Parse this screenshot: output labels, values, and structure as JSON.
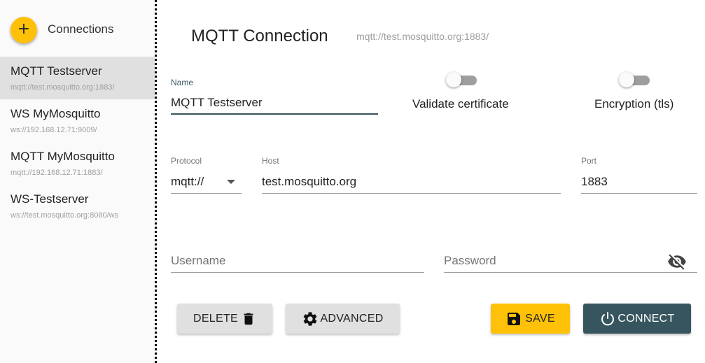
{
  "sidebar": {
    "title": "Connections",
    "add_icon": "plus-icon",
    "items": [
      {
        "name": "MQTT Testserver",
        "url": "mqtt://test.mosquitto.org:1883/",
        "selected": true
      },
      {
        "name": "WS MyMosquitto",
        "url": "ws://192.168.12.71:9009/",
        "selected": false
      },
      {
        "name": "MQTT MyMosquitto",
        "url": "mqtt://192.168.12.71:1883/",
        "selected": false
      },
      {
        "name": "WS-Testserver",
        "url": "ws://test.mosquitto.org:8080/ws",
        "selected": false
      }
    ]
  },
  "header": {
    "title": "MQTT Connection",
    "url": "mqtt://test.mosquitto.org:1883/"
  },
  "form": {
    "name_label": "Name",
    "name_value": "MQTT Testserver",
    "validate_label": "Validate certificate",
    "validate_on": false,
    "encryption_label": "Encryption (tls)",
    "encryption_on": false,
    "protocol_label": "Protocol",
    "protocol_value": "mqtt://",
    "host_label": "Host",
    "host_value": "test.mosquitto.org",
    "port_label": "Port",
    "port_value": "1883",
    "username_placeholder": "Username",
    "password_placeholder": "Password",
    "password_toggle_icon": "eye-off-icon"
  },
  "actions": {
    "delete_label": "DELETE",
    "delete_icon": "trash-icon",
    "advanced_label": "ADVANCED",
    "advanced_icon": "gear-icon",
    "save_label": "SAVE",
    "save_icon": "floppy-disk-icon",
    "connect_label": "CONNECT",
    "connect_icon": "power-icon"
  },
  "colors": {
    "accent_yellow": "#ffc107",
    "primary_teal": "#37555e",
    "selected_bg": "#e0e0e0"
  }
}
